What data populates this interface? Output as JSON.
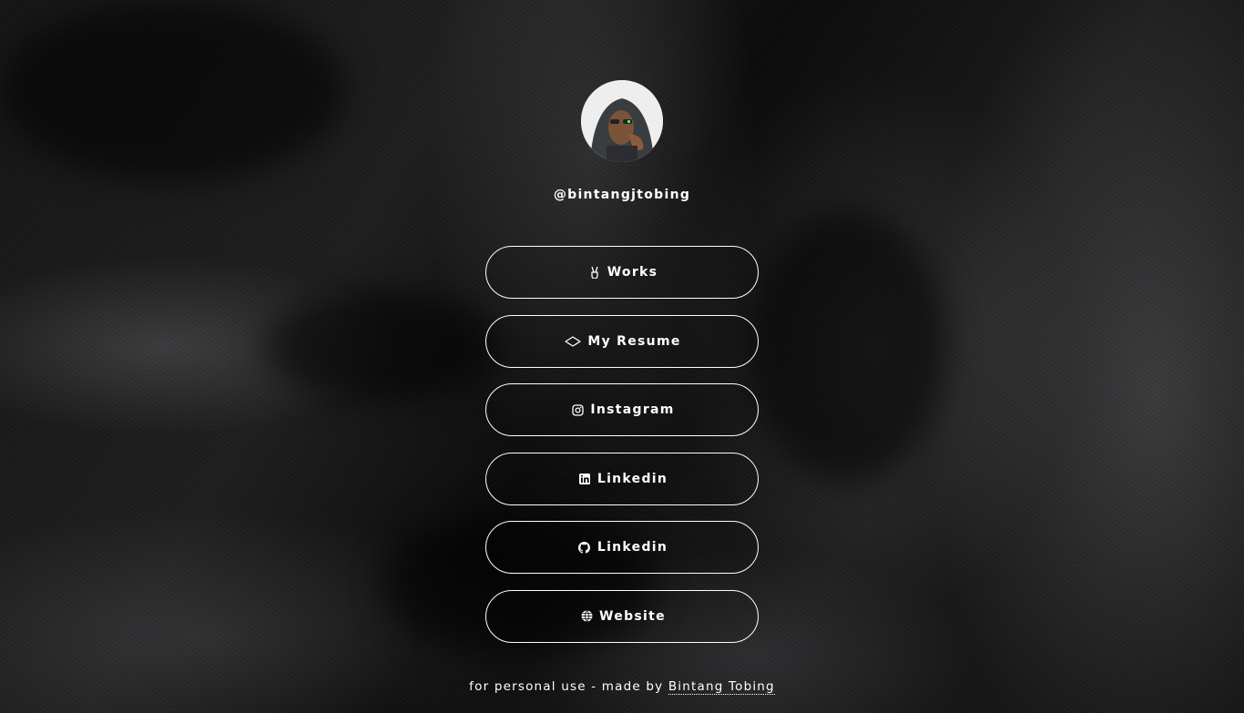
{
  "profile": {
    "handle": "@bintangjtobing",
    "avatar_icon": "profile-photo"
  },
  "links": [
    {
      "label": "Works",
      "icon": "victory-hand-icon"
    },
    {
      "label": "My Resume",
      "icon": "layers-icon"
    },
    {
      "label": "Instagram",
      "icon": "instagram-icon"
    },
    {
      "label": "Linkedin",
      "icon": "linkedin-icon"
    },
    {
      "label": "Linkedin",
      "icon": "github-icon"
    },
    {
      "label": "Website",
      "icon": "globe-icon"
    }
  ],
  "footer": {
    "prefix": "for personal use - made by ",
    "author_link": "Bintang Tobing"
  },
  "colors": {
    "text": "#ffffff",
    "border": "#ffffff",
    "background": "#0b0b0b"
  }
}
